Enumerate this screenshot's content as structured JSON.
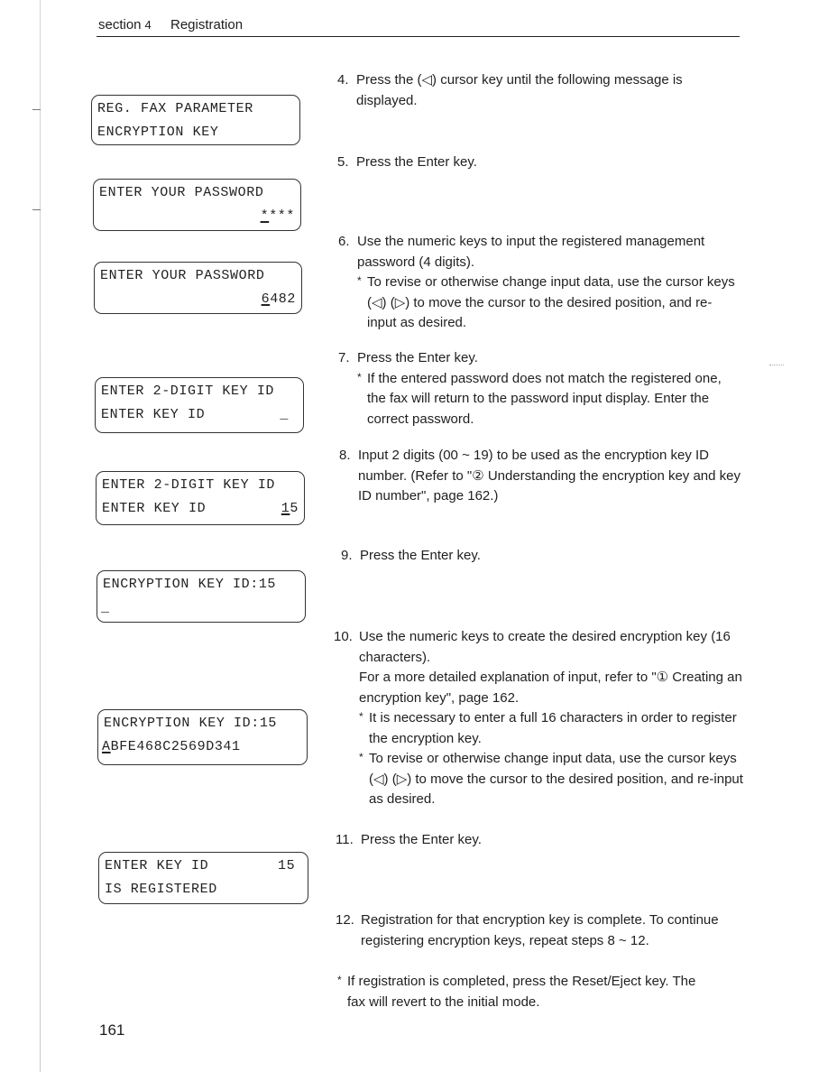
{
  "header": {
    "section_label": "section",
    "section_number": "4",
    "title": "Registration"
  },
  "displays": [
    {
      "line1": "REG. FAX PARAMETER",
      "line2": "ENCRYPTION KEY",
      "line2_cursor": "",
      "line2_rest": ""
    },
    {
      "line1": "ENTER YOUR PASSWORD",
      "line2": "",
      "line2_cursor": "*",
      "line2_rest": "***"
    },
    {
      "line1": "ENTER YOUR PASSWORD",
      "line2": "",
      "line2_cursor": "6",
      "line2_rest": "482"
    },
    {
      "line1": "ENTER 2-DIGIT KEY ID",
      "line2": "ENTER KEY ID",
      "line2_cursor": "_",
      "line2_rest": ""
    },
    {
      "line1": "ENTER 2-DIGIT KEY ID",
      "line2": "ENTER KEY ID",
      "line2_cursor": "1",
      "line2_rest": "5"
    },
    {
      "line1": "ENCRYPTION KEY ID:15",
      "line2": "",
      "line2_cursor": "_",
      "line2_rest": ""
    },
    {
      "line1": "ENCRYPTION KEY ID:15",
      "line2": "",
      "line2_cursor": "A",
      "line2_rest": "BFE468C2569D341"
    },
    {
      "line1": "ENTER KEY ID        15",
      "line2": "IS REGISTERED",
      "line2_cursor": "",
      "line2_rest": ""
    }
  ],
  "steps": [
    {
      "number": "4.",
      "text": "Press the (◁) cursor key until the following message is displayed.",
      "notes": []
    },
    {
      "number": "5.",
      "text": "Press the Enter key.",
      "notes": []
    },
    {
      "number": "6.",
      "text": "Use the numeric keys to input the registered management password (4 digits).",
      "notes": [
        "To revise or otherwise change input data, use the cursor keys (◁) (▷) to move the cursor to the desired position, and re-input as desired."
      ]
    },
    {
      "number": "7.",
      "text": "Press the Enter key.",
      "notes": [
        "If the entered password does not match the registered one, the fax will return to the password input display. Enter the correct password."
      ]
    },
    {
      "number": "8.",
      "text": "Input 2 digits (00 ~ 19) to be used as the encryption key ID number. (Refer to \"② Understanding the encryption key and key ID number\", page 162.)",
      "notes": []
    },
    {
      "number": "9.",
      "text": "Press the Enter key.",
      "notes": []
    },
    {
      "number": "10.",
      "text": "Use the numeric keys to create the desired encryption key (16 characters).",
      "extra": "For a more detailed explanation of input, refer to \"① Creating an encryption key\", page 162.",
      "notes": [
        "It is necessary to enter a full 16 characters in order to register the encryption key.",
        "To revise or otherwise change input data, use the cursor keys (◁) (▷) to move the cursor to the desired position, and re-input as desired."
      ]
    },
    {
      "number": "11.",
      "text": "Press the Enter key.",
      "notes": []
    },
    {
      "number": "12.",
      "text": "Registration for that encryption key is complete. To continue registering encryption keys, repeat steps 8 ~ 12.",
      "notes": []
    }
  ],
  "final_note": "If registration is completed, press the Reset/Eject key. The fax will revert to the initial mode.",
  "note_marker": "*",
  "page_number": "161"
}
